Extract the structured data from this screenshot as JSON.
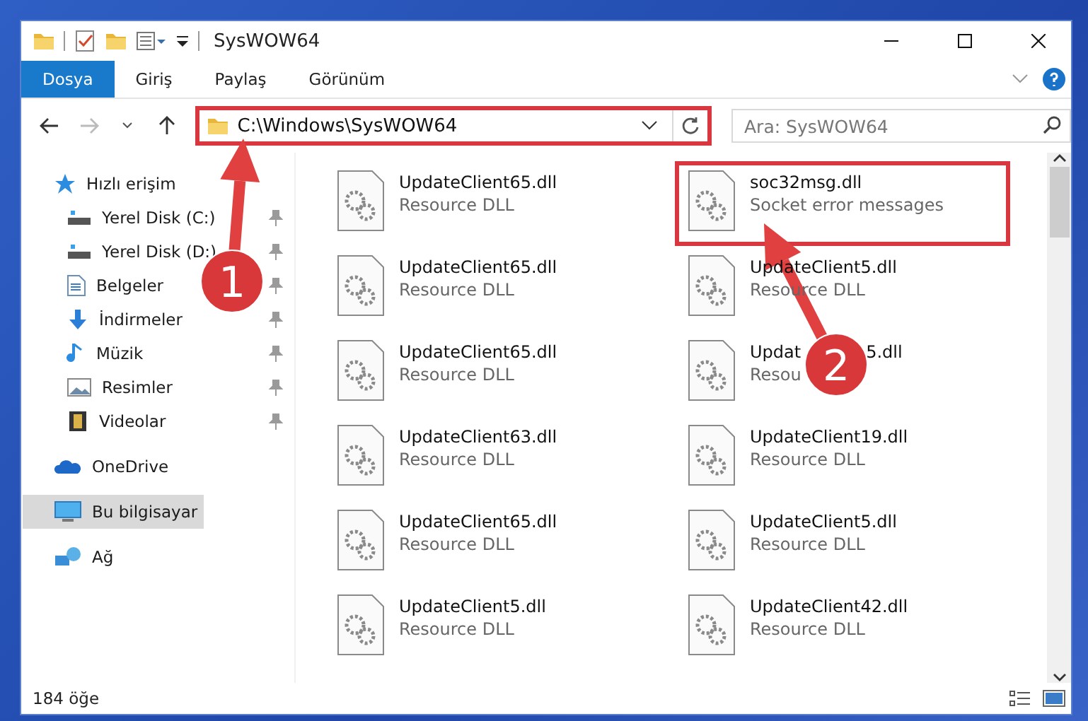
{
  "window": {
    "title": "SysWOW64"
  },
  "ribbon_tabs": [
    {
      "label": "Dosya",
      "selected": true
    },
    {
      "label": "Giriş",
      "selected": false
    },
    {
      "label": "Paylaş",
      "selected": false
    },
    {
      "label": "Görünüm",
      "selected": false
    }
  ],
  "address": {
    "path": "C:\\Windows\\SysWOW64",
    "highlighted": true
  },
  "search": {
    "placeholder": "Ara: SysWOW64"
  },
  "sidebar": {
    "items": [
      {
        "label": "Hızlı erişim",
        "kind": "star",
        "selected": false,
        "children": [
          {
            "label": "Yerel Disk (C:)",
            "kind": "drive",
            "pinned": true,
            "selected": false
          },
          {
            "label": "Yerel Disk (D:)",
            "kind": "drive",
            "pinned": true,
            "selected": false
          },
          {
            "label": "Belgeler",
            "kind": "document",
            "pinned": true,
            "selected": false
          },
          {
            "label": "İndirmeler",
            "kind": "download",
            "pinned": true,
            "selected": false
          },
          {
            "label": "Müzik",
            "kind": "music",
            "pinned": true,
            "selected": false
          },
          {
            "label": "Resimler",
            "kind": "pictures",
            "pinned": true,
            "selected": false
          },
          {
            "label": "Videolar",
            "kind": "video",
            "pinned": true,
            "selected": false
          }
        ]
      },
      {
        "label": "OneDrive",
        "kind": "cloud",
        "selected": false
      },
      {
        "label": "Bu bilgisayar",
        "kind": "computer",
        "selected": true
      },
      {
        "label": "Ağ",
        "kind": "network",
        "selected": false
      }
    ]
  },
  "files": [
    {
      "name": "UpdateClient65.dll",
      "description": "Resource DLL",
      "highlighted": false
    },
    {
      "name": "soc32msg.dll",
      "description": "Socket error messages",
      "highlighted": true
    },
    {
      "name": "UpdateClient65.dll",
      "description": "Resource DLL",
      "highlighted": false
    },
    {
      "name": "UpdateClient5.dll",
      "description": "Resource DLL",
      "highlighted": false
    },
    {
      "name": "UpdateClient65.dll",
      "description": "Resource DLL",
      "highlighted": false
    },
    {
      "name": "Updat",
      "name_end": "5.dll",
      "description": "Resou",
      "highlighted": false
    },
    {
      "name": "UpdateClient63.dll",
      "description": "Resource DLL",
      "highlighted": false
    },
    {
      "name": "UpdateClient19.dll",
      "description": "Resource DLL",
      "highlighted": false
    },
    {
      "name": "UpdateClient65.dll",
      "description": "Resource DLL",
      "highlighted": false
    },
    {
      "name": "UpdateClient5.dll",
      "description": "Resource DLL",
      "highlighted": false
    },
    {
      "name": "UpdateClient5.dll",
      "description": "Resource DLL",
      "highlighted": false
    },
    {
      "name": "UpdateClient42.dll",
      "description": "Resource DLL",
      "highlighted": false
    }
  ],
  "status_bar": {
    "count": "184 öğe"
  },
  "annotations": [
    {
      "number": "1"
    },
    {
      "number": "2"
    }
  ]
}
